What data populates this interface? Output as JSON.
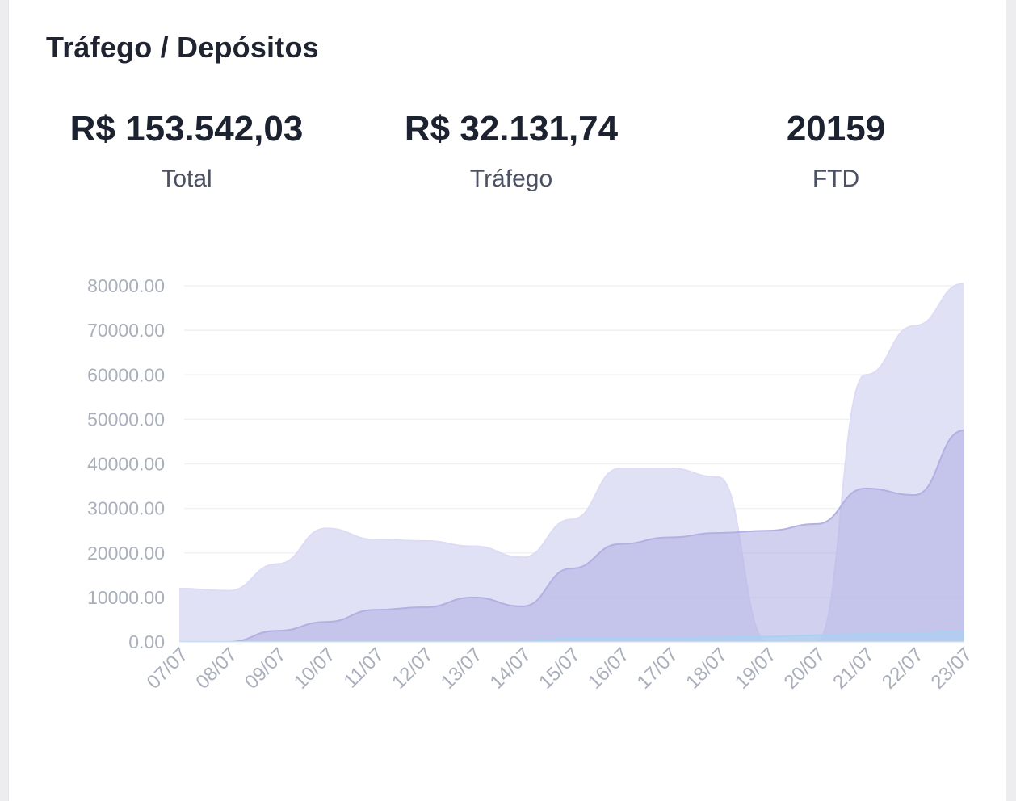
{
  "card": {
    "title": "Tráfego / Depósitos"
  },
  "stats": [
    {
      "value": "R$ 153.542,03",
      "label": "Total"
    },
    {
      "value": "R$ 32.131,74",
      "label": "Tráfego"
    },
    {
      "value": "20159",
      "label": "FTD"
    }
  ],
  "chart_data": {
    "type": "area",
    "title": "",
    "xlabel": "",
    "ylabel": "",
    "categories": [
      "07/07",
      "08/07",
      "09/07",
      "10/07",
      "11/07",
      "12/07",
      "13/07",
      "14/07",
      "15/07",
      "16/07",
      "17/07",
      "18/07",
      "19/07",
      "20/07",
      "21/07",
      "22/07",
      "23/07"
    ],
    "ylim": [
      0,
      80000
    ],
    "yticks": [
      "80000.00",
      "70000.00",
      "60000.00",
      "50000.00",
      "40000.00",
      "30000.00",
      "20000.00",
      "10000.00",
      "0.00"
    ],
    "grid": true,
    "legend": "none",
    "series": [
      {
        "color": "#dcdcf5",
        "values": [
          12000,
          11500,
          17500,
          25500,
          23000,
          22700,
          21500,
          19000,
          27500,
          39000,
          39000,
          37000,
          0,
          0,
          60000,
          71000,
          80500
        ]
      },
      {
        "color": "#b3b0e2",
        "values": [
          0,
          0,
          2500,
          4500,
          7200,
          7800,
          10000,
          8000,
          16500,
          22000,
          23500,
          24500,
          25000,
          26500,
          34500,
          33000,
          47500
        ]
      },
      {
        "color": "#a9d2f2",
        "values": [
          0,
          0,
          0,
          0,
          0,
          0,
          0,
          200,
          800,
          900,
          900,
          1000,
          1200,
          1500,
          1800,
          2000,
          2300
        ]
      }
    ]
  }
}
